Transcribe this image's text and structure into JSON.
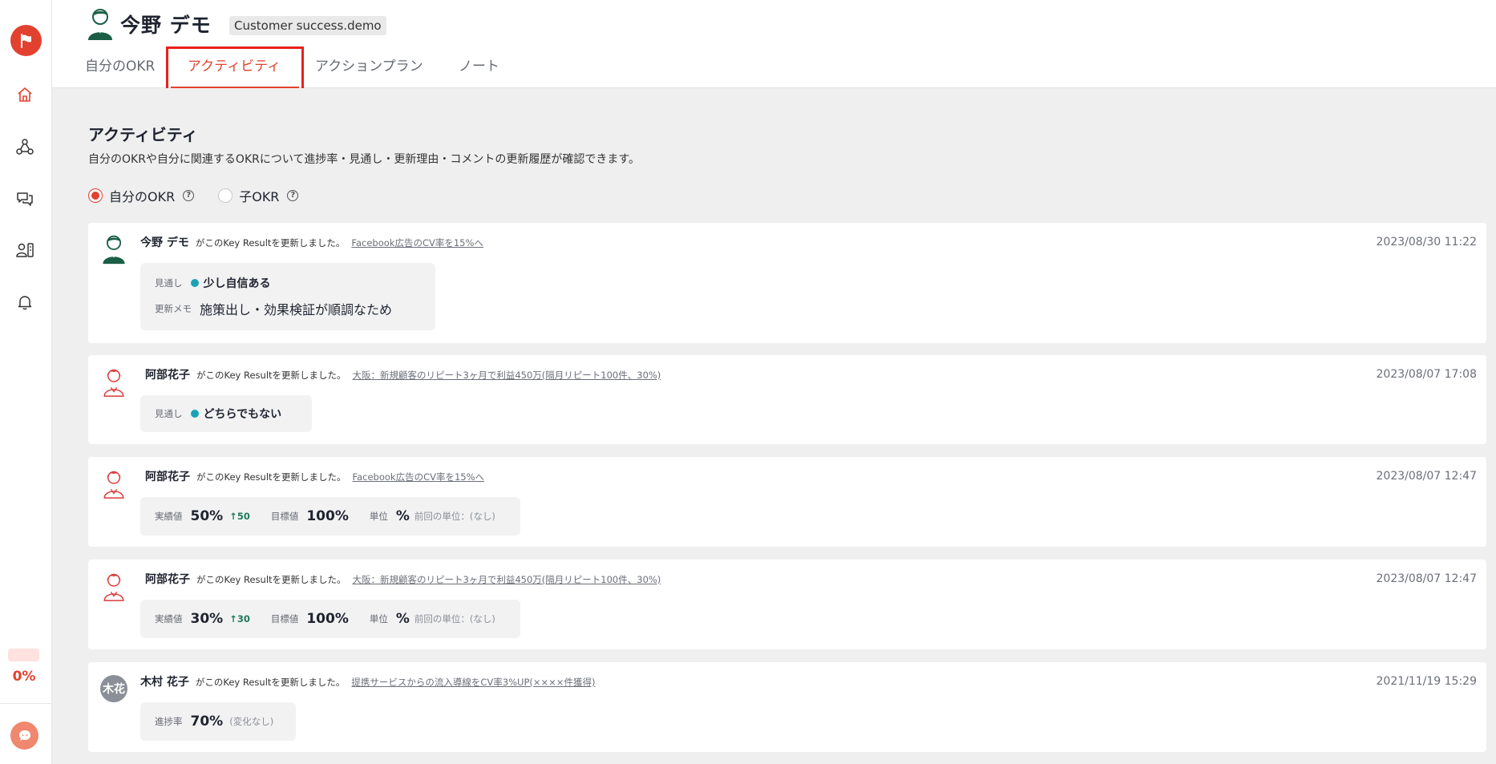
{
  "sidebar": {
    "logo": "flag-icon",
    "nav": [
      "home-icon",
      "network-icon",
      "chat-icon",
      "users-icon",
      "bell-icon"
    ],
    "progress_text": "0%",
    "chat_button": "chat-bubble-icon",
    "accent_color": "#e2412f"
  },
  "header": {
    "user_name": "今野 デモ",
    "org_badge": "Customer success.demo",
    "tabs": [
      {
        "label": "自分のOKR"
      },
      {
        "label": "アクティビティ",
        "active": true
      },
      {
        "label": "アクションプラン"
      },
      {
        "label": "ノート"
      }
    ]
  },
  "main": {
    "title": "アクティビティ",
    "description": "自分のOKRや自分に関連するOKRについて進捗率・見通し・更新理由・コメントの更新履歴が確認できます。",
    "filters": [
      {
        "label": "自分のOKR",
        "checked": true
      },
      {
        "label": "子OKR",
        "checked": false
      }
    ],
    "activities": [
      {
        "author": "今野 デモ",
        "action": "がこのKey Resultを更新しました。",
        "link": "Facebook広告のCV率を15%へ",
        "time": "2023/08/30 11:22",
        "outlook_label": "見通し",
        "outlook_value": "少し自信ある",
        "memo_label": "更新メモ",
        "memo_value": "施策出し・効果検証が順調なため"
      },
      {
        "author": "阿部花子",
        "action": "がこのKey Resultを更新しました。",
        "link": "大阪：新規顧客のリピート3ヶ月で利益450万(隔月リピート100件、30%)",
        "time": "2023/08/07 17:08",
        "outlook_label": "見通し",
        "outlook_value": "どちらでもない"
      },
      {
        "author": "阿部花子",
        "action": "がこのKey Resultを更新しました。",
        "link": "Facebook広告のCV率を15%へ",
        "time": "2023/08/07 12:47",
        "actual_label": "実績値",
        "actual_value": "50%",
        "delta": "↑50",
        "target_label": "目標値",
        "target_value": "100%",
        "unit_label": "単位",
        "unit_value": "%",
        "prev_unit": "前回の単位：(なし)"
      },
      {
        "author": "阿部花子",
        "action": "がこのKey Resultを更新しました。",
        "link": "大阪：新規顧客のリピート3ヶ月で利益450万(隔月リピート100件、30%)",
        "time": "2023/08/07 12:47",
        "actual_label": "実績値",
        "actual_value": "30%",
        "delta": "↑30",
        "target_label": "目標値",
        "target_value": "100%",
        "unit_label": "単位",
        "unit_value": "%",
        "prev_unit": "前回の単位：(なし)"
      },
      {
        "author": "木村 花子",
        "avatar_text": "木花",
        "action": "がこのKey Resultを更新しました。",
        "link": "提携サービスからの流入導線をCV率3%UP(××××件獲得)",
        "time": "2021/11/19 15:29",
        "progress_label": "進捗率",
        "progress_value": "70%",
        "progress_note": "(変化なし)"
      }
    ]
  }
}
